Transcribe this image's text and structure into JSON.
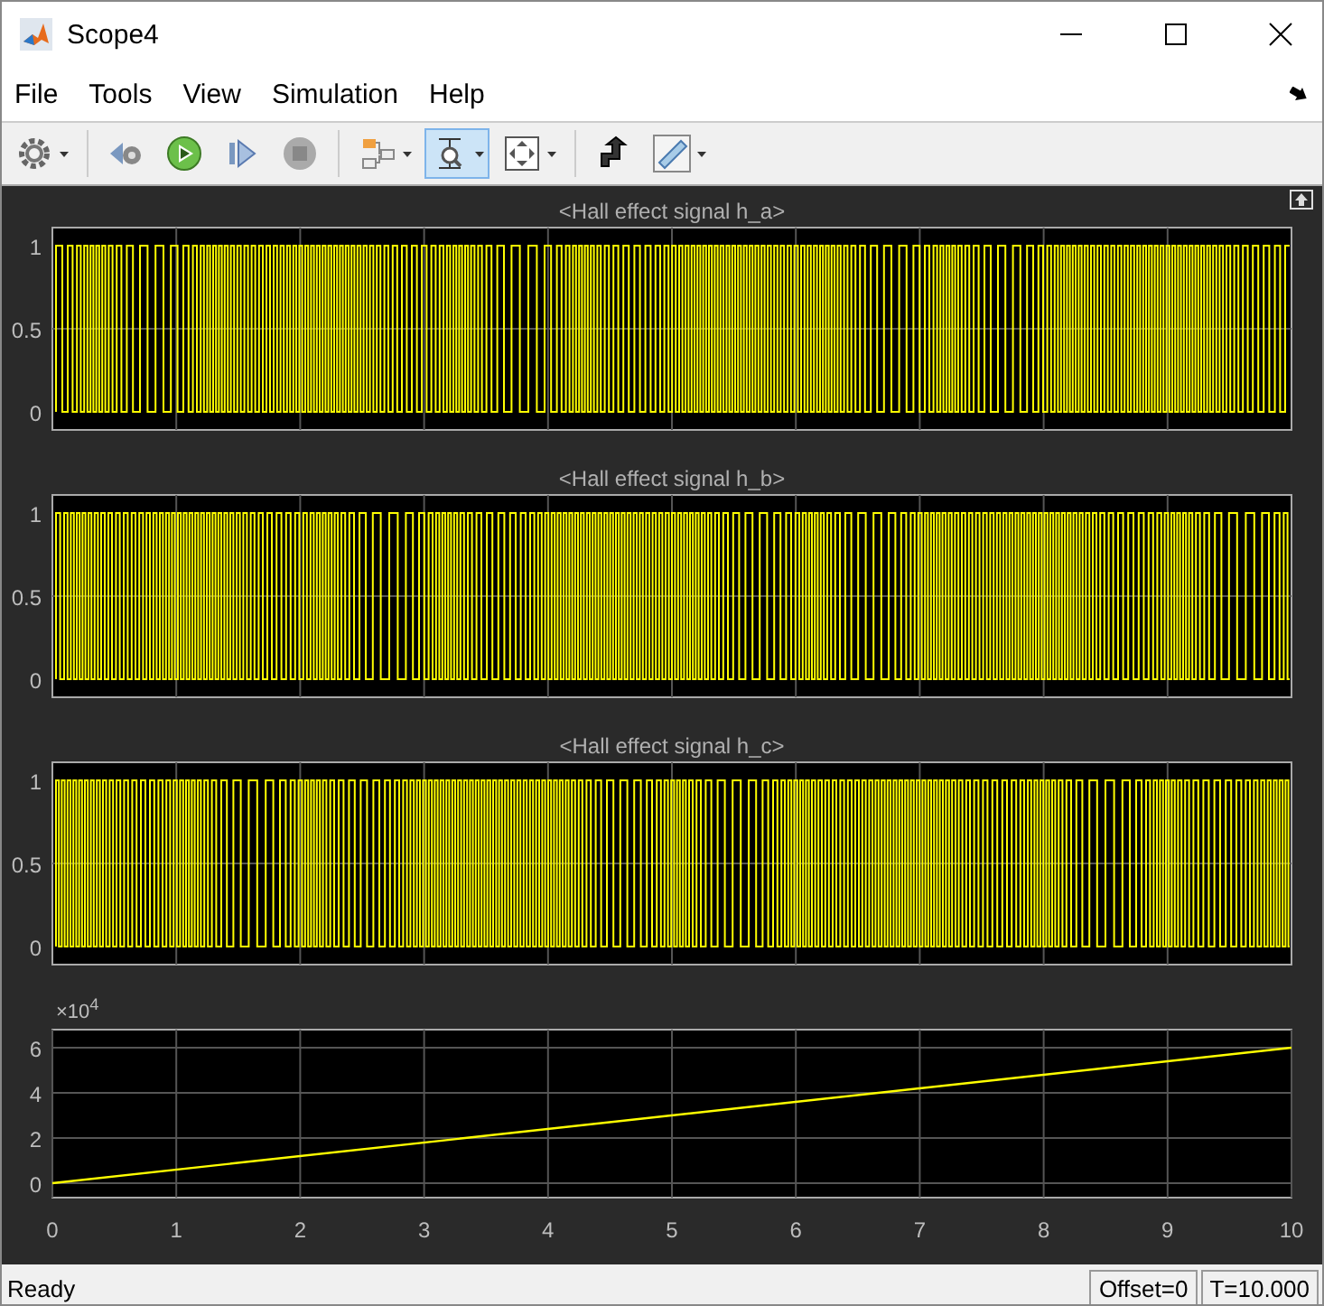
{
  "window": {
    "title": "Scope4"
  },
  "menu": [
    {
      "label": "File"
    },
    {
      "label": "Tools"
    },
    {
      "label": "View"
    },
    {
      "label": "Simulation"
    },
    {
      "label": "Help"
    }
  ],
  "toolbar": [
    {
      "kind": "settings",
      "dropdown": true,
      "selected": false
    },
    {
      "kind": "step_back",
      "dropdown": false,
      "selected": false
    },
    {
      "kind": "run",
      "dropdown": false,
      "selected": false
    },
    {
      "kind": "step_forward",
      "dropdown": false,
      "selected": false
    },
    {
      "kind": "stop",
      "dropdown": false,
      "selected": false
    },
    {
      "kind": "blocks",
      "dropdown": true,
      "selected": false
    },
    {
      "kind": "zoom",
      "dropdown": true,
      "selected": true
    },
    {
      "kind": "fit",
      "dropdown": true,
      "selected": false
    },
    {
      "kind": "highlight",
      "dropdown": false,
      "selected": false
    },
    {
      "kind": "ruler",
      "dropdown": true,
      "selected": false
    }
  ],
  "panels": [
    {
      "kind": "signal",
      "title": "<Hall effect signal h_a>",
      "yticks": [
        "1",
        "0.5",
        "0"
      ]
    },
    {
      "kind": "signal",
      "title": "<Hall effect signal h_b>",
      "yticks": [
        "1",
        "0.5",
        "0"
      ]
    },
    {
      "kind": "signal",
      "title": "<Hall effect signal h_c>",
      "yticks": [
        "1",
        "0.5",
        "0"
      ]
    },
    {
      "kind": "chart",
      "exponent_label": "×10$^{4}$",
      "chart_data": {
        "type": "line",
        "x": [
          0,
          10
        ],
        "series": [
          {
            "color": "#ffff00",
            "values": [
              0,
              6
            ]
          }
        ],
        "xlim": [
          0,
          10
        ],
        "ylim": [
          -0.64,
          6.8
        ],
        "xticks": [
          0,
          1,
          2,
          3,
          4,
          5,
          6,
          7,
          8,
          9,
          10
        ],
        "yticks": [
          0,
          2,
          4,
          6
        ],
        "grid": true
      }
    }
  ],
  "status_bar": {
    "message": "Ready",
    "fields": [
      "Offset=0",
      "T=10.000"
    ]
  }
}
